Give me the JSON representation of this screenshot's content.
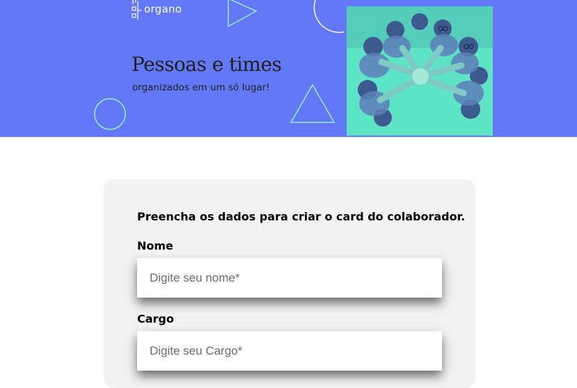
{
  "banner": {
    "logo_text": "organo",
    "headline": "Pessoas e times",
    "subheadline": "organizados em um só lugar!",
    "background_color": "#6278f7",
    "accent_color": "#66e9c9",
    "photo_description_icon": "team-hands-together-image"
  },
  "form": {
    "title": "Preencha os dados para criar o card do colaborador.",
    "fields": [
      {
        "label": "Nome",
        "placeholder": "Digite seu nome*",
        "value": ""
      },
      {
        "label": "Cargo",
        "placeholder": "Digite seu Cargo*",
        "value": ""
      }
    ]
  }
}
